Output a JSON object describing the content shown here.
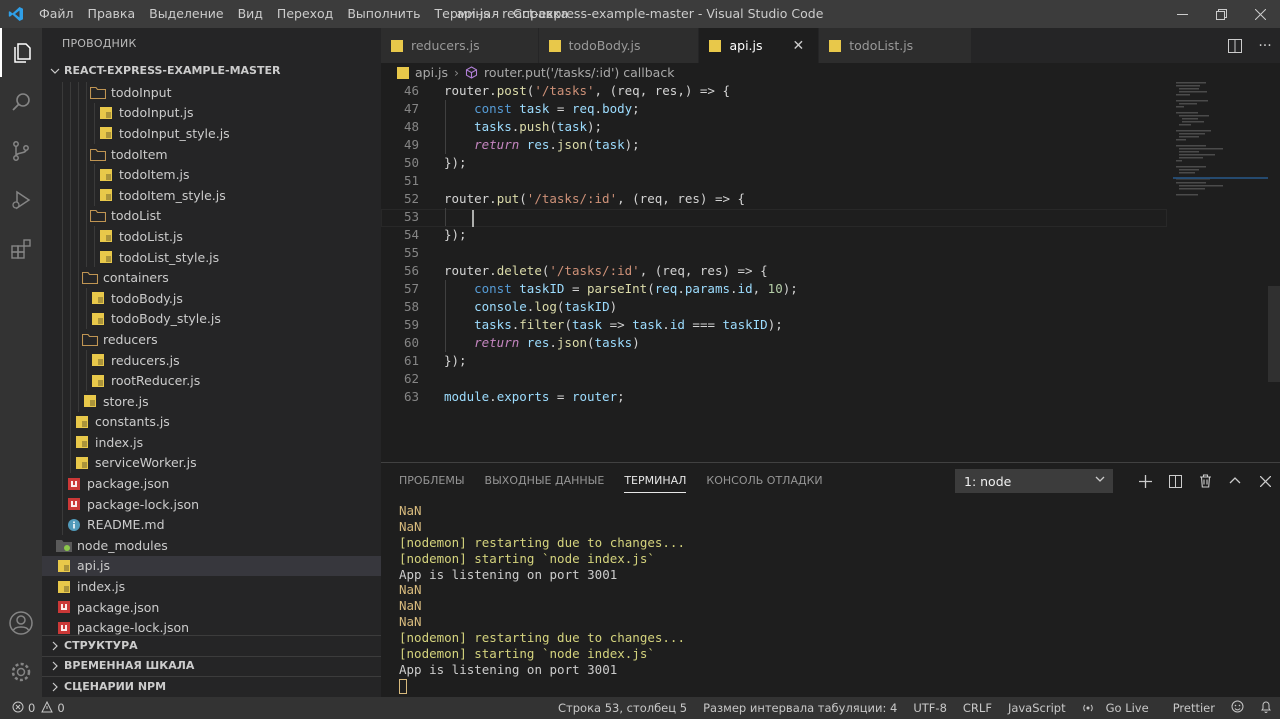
{
  "titlebar": {
    "title": "api.js - react-express-example-master - Visual Studio Code",
    "menu": [
      "Файл",
      "Правка",
      "Выделение",
      "Вид",
      "Переход",
      "Выполнить",
      "Терминал",
      "Справка"
    ]
  },
  "sidebar": {
    "title": "ПРОВОДНИК",
    "root": "REACT-EXPRESS-EXAMPLE-MASTER",
    "tree": [
      {
        "label": "todoInput",
        "type": "folder",
        "depth": 3
      },
      {
        "label": "todoInput.js",
        "type": "js",
        "depth": 4
      },
      {
        "label": "todoInput_style.js",
        "type": "js",
        "depth": 4
      },
      {
        "label": "todoItem",
        "type": "folder",
        "depth": 3
      },
      {
        "label": "todoItem.js",
        "type": "js",
        "depth": 4
      },
      {
        "label": "todoItem_style.js",
        "type": "js",
        "depth": 4
      },
      {
        "label": "todoList",
        "type": "folder",
        "depth": 3
      },
      {
        "label": "todoList.js",
        "type": "js",
        "depth": 4
      },
      {
        "label": "todoList_style.js",
        "type": "js",
        "depth": 4
      },
      {
        "label": "containers",
        "type": "folder",
        "depth": 2
      },
      {
        "label": "todoBody.js",
        "type": "js",
        "depth": 3
      },
      {
        "label": "todoBody_style.js",
        "type": "js",
        "depth": 3
      },
      {
        "label": "reducers",
        "type": "folder",
        "depth": 2
      },
      {
        "label": "reducers.js",
        "type": "js",
        "depth": 3
      },
      {
        "label": "rootReducer.js",
        "type": "js",
        "depth": 3
      },
      {
        "label": "store.js",
        "type": "js",
        "depth": 2
      },
      {
        "label": "constants.js",
        "type": "js",
        "depth": 1
      },
      {
        "label": "index.js",
        "type": "js",
        "depth": 1
      },
      {
        "label": "serviceWorker.js",
        "type": "js",
        "depth": 1
      },
      {
        "label": "package.json",
        "type": "npm",
        "depth": 0
      },
      {
        "label": "package-lock.json",
        "type": "npm",
        "depth": 0
      },
      {
        "label": "README.md",
        "type": "info",
        "depth": 0
      },
      {
        "label": "node_modules",
        "type": "nodefolder",
        "depth": -1
      },
      {
        "label": "api.js",
        "type": "js",
        "depth": -1,
        "selected": true
      },
      {
        "label": "index.js",
        "type": "js",
        "depth": -1
      },
      {
        "label": "package.json",
        "type": "npm",
        "depth": -1
      },
      {
        "label": "package-lock.json",
        "type": "npm",
        "depth": -1
      }
    ],
    "panels": [
      "СТРУКТУРА",
      "ВРЕМЕННАЯ ШКАЛА",
      "СЦЕНАРИИ NPM"
    ]
  },
  "tabs": [
    {
      "label": "reducers.js"
    },
    {
      "label": "todoBody.js"
    },
    {
      "label": "api.js",
      "active": true
    },
    {
      "label": "todoList.js"
    }
  ],
  "breadcrumb": {
    "file": "api.js",
    "symbol": "router.put('/tasks/:id') callback"
  },
  "editor": {
    "lines": [
      {
        "n": "46",
        "t": [
          [
            "p",
            "router."
          ],
          [
            "f",
            "post"
          ],
          [
            "p",
            "("
          ],
          [
            "s",
            "'/tasks'"
          ],
          [
            "p",
            ", (req, res,) => {"
          ]
        ]
      },
      {
        "n": "47",
        "t": [
          [
            "p",
            "    "
          ],
          [
            "kw",
            "const "
          ],
          [
            "v",
            "task"
          ],
          [
            "p",
            " = "
          ],
          [
            "v",
            "req"
          ],
          [
            "p",
            "."
          ],
          [
            "v",
            "body"
          ],
          [
            "p",
            ";"
          ]
        ]
      },
      {
        "n": "48",
        "t": [
          [
            "p",
            "    "
          ],
          [
            "v",
            "tasks"
          ],
          [
            "p",
            "."
          ],
          [
            "f",
            "push"
          ],
          [
            "p",
            "("
          ],
          [
            "v",
            "task"
          ],
          [
            "p",
            ");"
          ]
        ]
      },
      {
        "n": "49",
        "t": [
          [
            "p",
            "    "
          ],
          [
            "k it",
            "return "
          ],
          [
            "v",
            "res"
          ],
          [
            "p",
            "."
          ],
          [
            "f",
            "json"
          ],
          [
            "p",
            "("
          ],
          [
            "v",
            "task"
          ],
          [
            "p",
            ");"
          ]
        ]
      },
      {
        "n": "50",
        "t": [
          [
            "p",
            "});"
          ]
        ]
      },
      {
        "n": "51",
        "t": []
      },
      {
        "n": "52",
        "t": [
          [
            "p",
            "router."
          ],
          [
            "f",
            "put"
          ],
          [
            "p",
            "("
          ],
          [
            "s",
            "'/tasks/:id'"
          ],
          [
            "p",
            ", (req, res) => {"
          ]
        ]
      },
      {
        "n": "53",
        "t": []
      },
      {
        "n": "54",
        "t": [
          [
            "p",
            "});"
          ]
        ]
      },
      {
        "n": "55",
        "t": []
      },
      {
        "n": "56",
        "t": [
          [
            "p",
            "router."
          ],
          [
            "f",
            "delete"
          ],
          [
            "p",
            "("
          ],
          [
            "s",
            "'/tasks/:id'"
          ],
          [
            "p",
            ", (req, res) => {"
          ]
        ]
      },
      {
        "n": "57",
        "t": [
          [
            "p",
            "    "
          ],
          [
            "kw",
            "const "
          ],
          [
            "v",
            "taskID"
          ],
          [
            "p",
            " = "
          ],
          [
            "f",
            "parseInt"
          ],
          [
            "p",
            "("
          ],
          [
            "v",
            "req"
          ],
          [
            "p",
            "."
          ],
          [
            "v",
            "params"
          ],
          [
            "p",
            "."
          ],
          [
            "v",
            "id"
          ],
          [
            "p",
            ", "
          ],
          [
            "n",
            "10"
          ],
          [
            "p",
            ");"
          ]
        ]
      },
      {
        "n": "58",
        "t": [
          [
            "p",
            "    "
          ],
          [
            "v",
            "console"
          ],
          [
            "p",
            "."
          ],
          [
            "f",
            "log"
          ],
          [
            "p",
            "("
          ],
          [
            "v",
            "taskID"
          ],
          [
            "p",
            ")"
          ]
        ]
      },
      {
        "n": "59",
        "t": [
          [
            "p",
            "    "
          ],
          [
            "v",
            "tasks"
          ],
          [
            "p",
            "."
          ],
          [
            "f",
            "filter"
          ],
          [
            "p",
            "("
          ],
          [
            "v",
            "task"
          ],
          [
            "p",
            " => "
          ],
          [
            "v",
            "task"
          ],
          [
            "p",
            "."
          ],
          [
            "v",
            "id"
          ],
          [
            "p",
            " === "
          ],
          [
            "v",
            "taskID"
          ],
          [
            "p",
            ");"
          ]
        ]
      },
      {
        "n": "60",
        "t": [
          [
            "p",
            "    "
          ],
          [
            "k it",
            "return "
          ],
          [
            "v",
            "res"
          ],
          [
            "p",
            "."
          ],
          [
            "f",
            "json"
          ],
          [
            "p",
            "("
          ],
          [
            "v",
            "tasks"
          ],
          [
            "p",
            ")"
          ]
        ]
      },
      {
        "n": "61",
        "t": [
          [
            "p",
            "});"
          ]
        ]
      },
      {
        "n": "62",
        "t": []
      },
      {
        "n": "63",
        "t": [
          [
            "v",
            "module"
          ],
          [
            "p",
            "."
          ],
          [
            "v",
            "exports"
          ],
          [
            "p",
            " = "
          ],
          [
            "v",
            "router"
          ],
          [
            "p",
            ";"
          ]
        ]
      }
    ]
  },
  "panel": {
    "tabs": [
      "ПРОБЛЕМЫ",
      "ВЫХОДНЫЕ ДАННЫЕ",
      "ТЕРМИНАЛ",
      "КОНСОЛЬ ОТЛАДКИ"
    ],
    "active_tab": 2,
    "terminal_select": "1: node",
    "terminal": [
      {
        "c": "tyel",
        "t": "NaN"
      },
      {
        "c": "tyel",
        "t": "NaN"
      },
      {
        "c": "tgreen",
        "t": "[nodemon] restarting due to changes..."
      },
      {
        "c": "tgreen",
        "t": "[nodemon] starting `node index.js`"
      },
      {
        "c": "twhite",
        "t": "App is listening on port 3001"
      },
      {
        "c": "tyel",
        "t": "NaN"
      },
      {
        "c": "tyel",
        "t": "NaN"
      },
      {
        "c": "tyel",
        "t": "NaN"
      },
      {
        "c": "tgreen",
        "t": "[nodemon] restarting due to changes..."
      },
      {
        "c": "tgreen",
        "t": "[nodemon] starting `node index.js`"
      },
      {
        "c": "twhite",
        "t": "App is listening on port 3001"
      }
    ]
  },
  "status": {
    "errors": "0",
    "warnings": "0",
    "position": "Строка 53, столбец 5",
    "indent": "Размер интервала табуляции: 4",
    "encoding": "UTF-8",
    "eol": "CRLF",
    "language": "JavaScript",
    "golive": "Go Live",
    "prettier": "Prettier"
  },
  "colors": {
    "js_icon": "#e8c84a",
    "npm_icon": "#cb3837",
    "folder": "#c09553",
    "accent": "#007acc"
  }
}
